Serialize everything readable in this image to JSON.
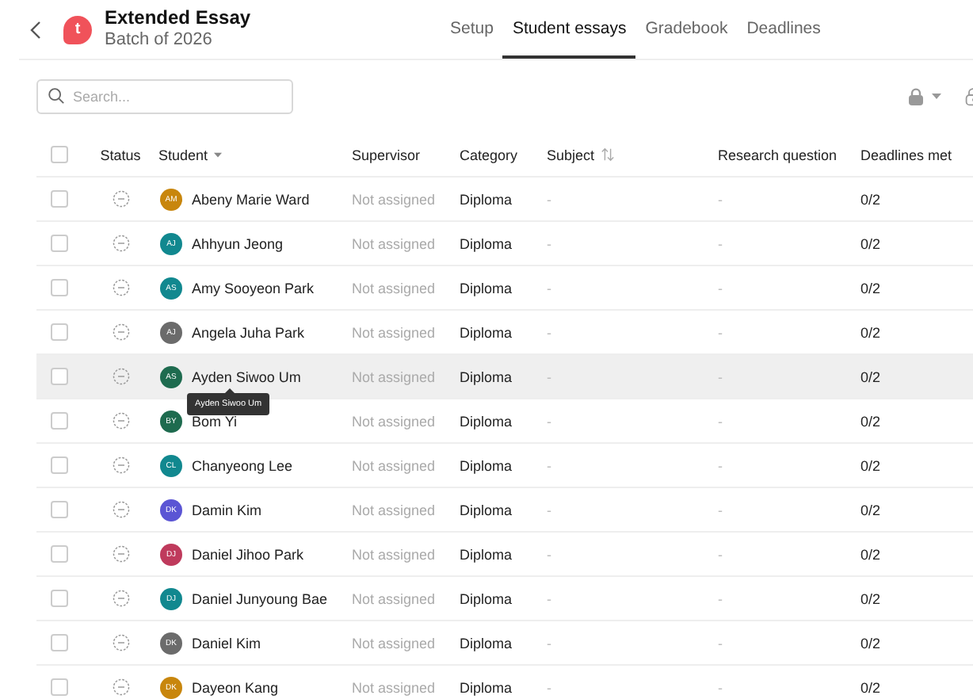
{
  "header": {
    "title": "Extended Essay",
    "subtitle": "Batch of 2026",
    "logo": "t"
  },
  "tabs": [
    {
      "label": "Setup",
      "selected": false
    },
    {
      "label": "Student essays",
      "selected": true
    },
    {
      "label": "Gradebook",
      "selected": false
    },
    {
      "label": "Deadlines",
      "selected": false
    }
  ],
  "search": {
    "placeholder": "Search..."
  },
  "table": {
    "select_all": {
      "checked": false
    },
    "columns": [
      "Status",
      "Student",
      "Supervisor",
      "Category",
      "Subject",
      "Research question",
      "Deadlines met"
    ],
    "rows": [
      {
        "checked": false,
        "initials": "AM",
        "color": "#c8860d",
        "student": "Abeny Marie Ward",
        "supervisor": "Not assigned",
        "category": "Diploma",
        "subject": "-",
        "research_question": "-",
        "deadlines_met": "0/2",
        "hovered": false
      },
      {
        "checked": false,
        "initials": "AJ",
        "color": "#11888f",
        "student": "Ahhyun Jeong",
        "supervisor": "Not assigned",
        "category": "Diploma",
        "subject": "-",
        "research_question": "-",
        "deadlines_met": "0/2",
        "hovered": false
      },
      {
        "checked": false,
        "initials": "AS",
        "color": "#11888f",
        "student": "Amy Sooyeon Park",
        "supervisor": "Not assigned",
        "category": "Diploma",
        "subject": "-",
        "research_question": "-",
        "deadlines_met": "0/2",
        "hovered": false
      },
      {
        "checked": false,
        "initials": "AJ",
        "color": "#6b6b6b",
        "student": "Angela Juha Park",
        "supervisor": "Not assigned",
        "category": "Diploma",
        "subject": "-",
        "research_question": "-",
        "deadlines_met": "0/2",
        "hovered": false
      },
      {
        "checked": false,
        "initials": "AS",
        "color": "#1e6b4f",
        "student": "Ayden Siwoo Um",
        "supervisor": "Not assigned",
        "category": "Diploma",
        "subject": "-",
        "research_question": "-",
        "deadlines_met": "0/2",
        "hovered": true,
        "tooltip": "Ayden Siwoo Um"
      },
      {
        "checked": false,
        "initials": "BY",
        "color": "#1e6b4f",
        "student": "Bom Yi",
        "supervisor": "Not assigned",
        "category": "Diploma",
        "subject": "-",
        "research_question": "-",
        "deadlines_met": "0/2",
        "hovered": false
      },
      {
        "checked": false,
        "initials": "CL",
        "color": "#11888f",
        "student": "Chanyeong Lee",
        "supervisor": "Not assigned",
        "category": "Diploma",
        "subject": "-",
        "research_question": "-",
        "deadlines_met": "0/2",
        "hovered": false
      },
      {
        "checked": false,
        "initials": "DK",
        "color": "#5b55d4",
        "student": "Damin Kim",
        "supervisor": "Not assigned",
        "category": "Diploma",
        "subject": "-",
        "research_question": "-",
        "deadlines_met": "0/2",
        "hovered": false
      },
      {
        "checked": false,
        "initials": "DJ",
        "color": "#bf3a5c",
        "student": "Daniel Jihoo Park",
        "supervisor": "Not assigned",
        "category": "Diploma",
        "subject": "-",
        "research_question": "-",
        "deadlines_met": "0/2",
        "hovered": false
      },
      {
        "checked": false,
        "initials": "DJ",
        "color": "#11888f",
        "student": "Daniel Junyoung Bae",
        "supervisor": "Not assigned",
        "category": "Diploma",
        "subject": "-",
        "research_question": "-",
        "deadlines_met": "0/2",
        "hovered": false
      },
      {
        "checked": false,
        "initials": "DK",
        "color": "#6b6b6b",
        "student": "Daniel Kim",
        "supervisor": "Not assigned",
        "category": "Diploma",
        "subject": "-",
        "research_question": "-",
        "deadlines_met": "0/2",
        "hovered": false
      },
      {
        "checked": false,
        "initials": "DK",
        "color": "#c8860d",
        "student": "Dayeon Kang",
        "supervisor": "Not assigned",
        "category": "Diploma",
        "subject": "-",
        "research_question": "-",
        "deadlines_met": "0/2",
        "hovered": false
      }
    ]
  }
}
